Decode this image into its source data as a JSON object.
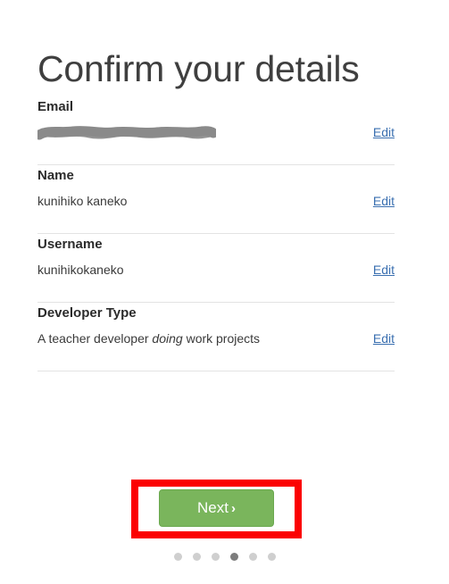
{
  "page": {
    "title": "Confirm your details",
    "background_color": "#ffffff"
  },
  "details": {
    "edit_label": "Edit",
    "rows": [
      {
        "label": "Email",
        "value": "",
        "redacted": true,
        "edit_label": "Edit"
      },
      {
        "label": "Name",
        "value": "kunihiko kaneko",
        "redacted": false,
        "edit_label": "Edit"
      },
      {
        "label": "Username",
        "value": "kunihikokaneko",
        "redacted": false,
        "edit_label": "Edit"
      },
      {
        "label": "Developer Type",
        "value_prefix": "A teacher developer ",
        "value_emphasis": "doing",
        "value_suffix": " work projects",
        "value": "A teacher developer doing work projects",
        "redacted": false,
        "edit_label": "Edit"
      }
    ]
  },
  "footer": {
    "next_button": {
      "label": "Next",
      "chevron": "›",
      "color": "#7ab55c",
      "text_color": "#ffffff"
    },
    "annotation": {
      "type": "highlight-rectangle",
      "color": "#fb0203",
      "target": "next-button"
    },
    "steps": {
      "total": 6,
      "current": 4,
      "inactive_color": "#cfcfcf",
      "active_color": "#7d7d7d"
    }
  },
  "colors": {
    "link": "#3a6fb0",
    "title": "#3f3f3f",
    "divider": "#e3e3e3",
    "redaction": "#8a8a8a"
  }
}
